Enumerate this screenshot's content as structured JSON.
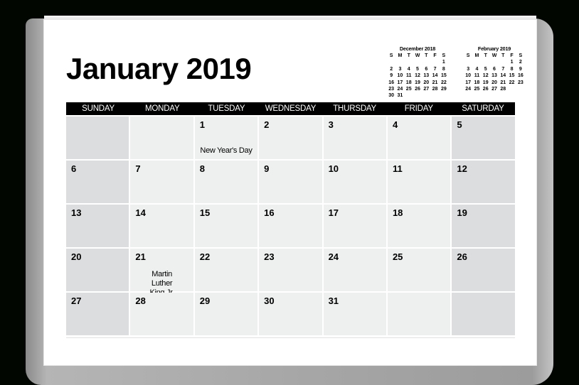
{
  "calendar": {
    "title": "January 2019",
    "weekdays": [
      "SUNDAY",
      "MONDAY",
      "TUESDAY",
      "WEDNESDAY",
      "THURSDAY",
      "FRIDAY",
      "SATURDAY"
    ],
    "weeks": [
      [
        {
          "day": ""
        },
        {
          "day": ""
        },
        {
          "day": "1",
          "event": "New Year's Day"
        },
        {
          "day": "2"
        },
        {
          "day": "3"
        },
        {
          "day": "4"
        },
        {
          "day": "5"
        }
      ],
      [
        {
          "day": "6"
        },
        {
          "day": "7"
        },
        {
          "day": "8"
        },
        {
          "day": "9"
        },
        {
          "day": "10"
        },
        {
          "day": "11"
        },
        {
          "day": "12"
        }
      ],
      [
        {
          "day": "13"
        },
        {
          "day": "14"
        },
        {
          "day": "15"
        },
        {
          "day": "16"
        },
        {
          "day": "17"
        },
        {
          "day": "18"
        },
        {
          "day": "19"
        }
      ],
      [
        {
          "day": "20"
        },
        {
          "day": "21",
          "event": "Martin Luther King Jr. Day"
        },
        {
          "day": "22"
        },
        {
          "day": "23"
        },
        {
          "day": "24"
        },
        {
          "day": "25"
        },
        {
          "day": "26"
        }
      ],
      [
        {
          "day": "27"
        },
        {
          "day": "28"
        },
        {
          "day": "29"
        },
        {
          "day": "30"
        },
        {
          "day": "31"
        },
        {
          "day": ""
        },
        {
          "day": ""
        }
      ]
    ]
  },
  "mini_calendars": [
    {
      "title": "December 2018",
      "weekday_initials": [
        "S",
        "M",
        "T",
        "W",
        "T",
        "F",
        "S"
      ],
      "days": [
        "",
        "",
        "",
        "",
        "",
        "",
        "1",
        "2",
        "3",
        "4",
        "5",
        "6",
        "7",
        "8",
        "9",
        "10",
        "11",
        "12",
        "13",
        "14",
        "15",
        "16",
        "17",
        "18",
        "19",
        "20",
        "21",
        "22",
        "23",
        "24",
        "25",
        "26",
        "27",
        "28",
        "29",
        "30",
        "31"
      ]
    },
    {
      "title": "February 2019",
      "weekday_initials": [
        "S",
        "M",
        "T",
        "W",
        "T",
        "F",
        "S"
      ],
      "days": [
        "",
        "",
        "",
        "",
        "",
        "1",
        "2",
        "3",
        "4",
        "5",
        "6",
        "7",
        "8",
        "9",
        "10",
        "11",
        "12",
        "13",
        "14",
        "15",
        "16",
        "17",
        "18",
        "19",
        "20",
        "21",
        "22",
        "23",
        "24",
        "25",
        "26",
        "27",
        "28"
      ]
    }
  ],
  "colors": {
    "background": "#010601",
    "header_bar": "#000000",
    "weekday_cell": "#eeefef",
    "weekend_cell": "#dcdddf"
  }
}
